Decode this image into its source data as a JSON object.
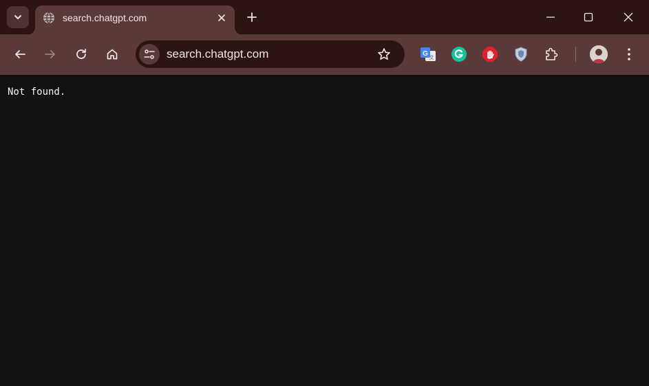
{
  "colors": {
    "frame": "#2c1413",
    "toolbar": "#5a3a38",
    "content_bg": "#121212",
    "text": "#f1e6e5"
  },
  "tab": {
    "title": "search.chatgpt.com",
    "favicon": "globe-icon"
  },
  "omnibox": {
    "url": "search.chatgpt.com"
  },
  "extensions": [
    "google-translate-icon",
    "grammarly-icon",
    "adblock-icon",
    "shield-icon",
    "puzzle-icon"
  ],
  "page": {
    "body_text": "Not found."
  }
}
